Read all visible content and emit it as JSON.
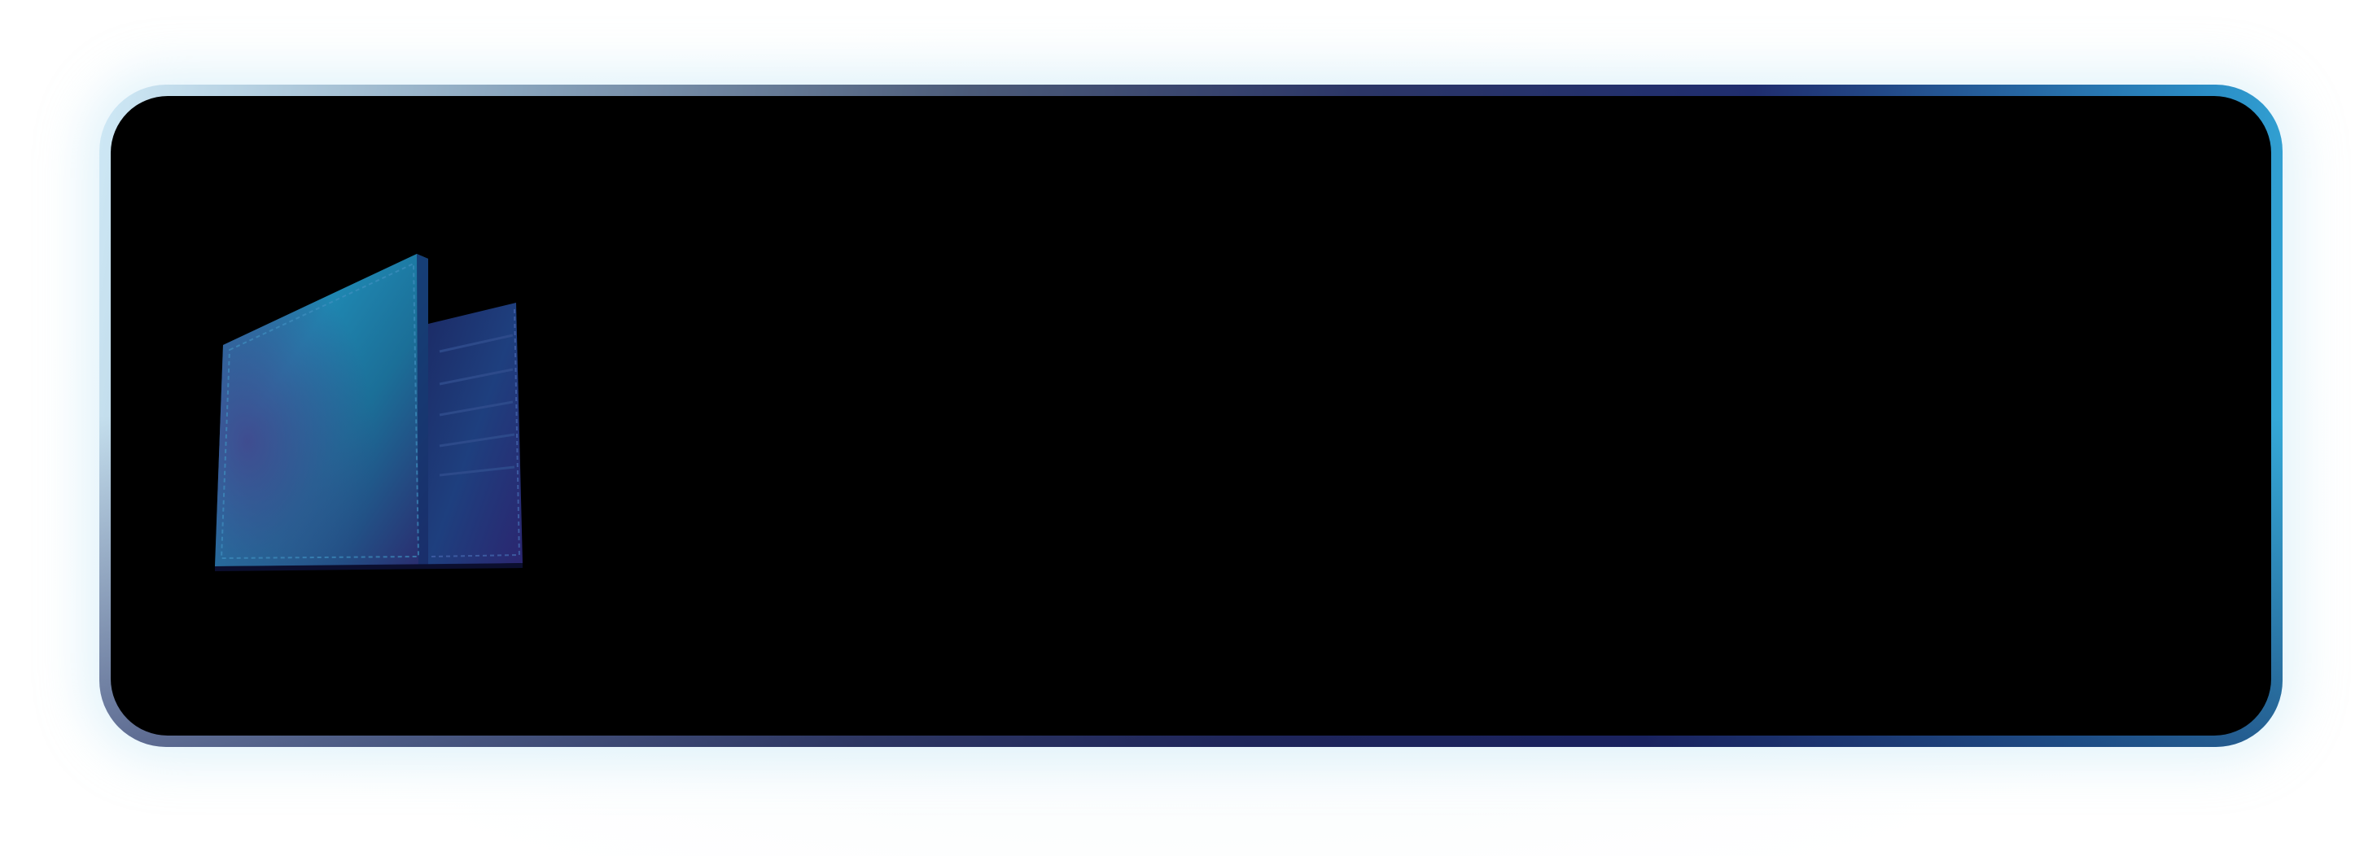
{
  "banner": {
    "image": {
      "icon": "wallet-icon",
      "colors": {
        "leather_teal": "#1f7fa6",
        "leather_purple": "#3a2f7a",
        "leather_dark": "#141a4e"
      }
    },
    "colors": {
      "background": "#000000",
      "border_start": "#cfe9f6",
      "border_mid": "#2b3566",
      "border_end": "#3ab6e0"
    }
  }
}
